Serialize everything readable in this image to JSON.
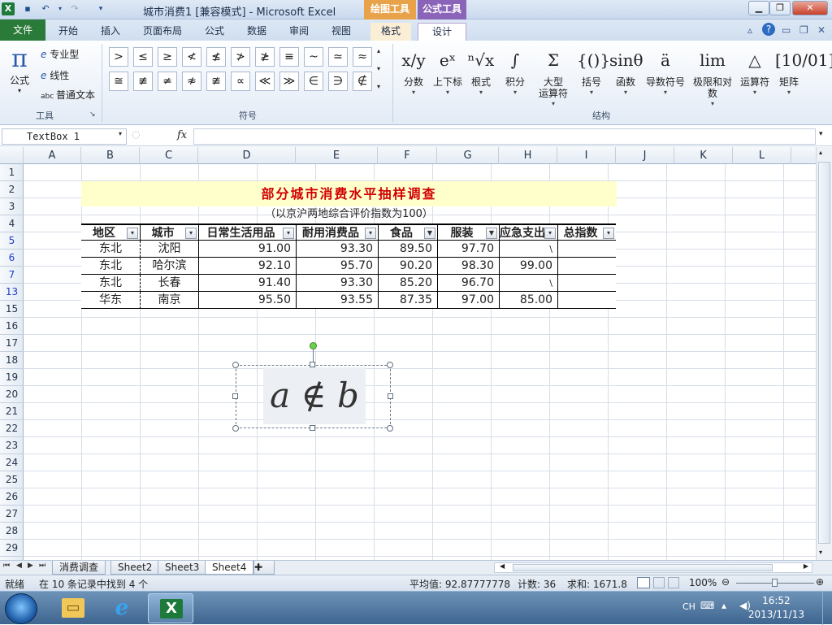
{
  "window": {
    "title": "城市消费1  [兼容模式] - Microsoft Excel",
    "context_tab_drawing": "绘图工具",
    "context_tab_formula": "公式工具"
  },
  "tabs": [
    "文件",
    "开始",
    "插入",
    "页面布局",
    "公式",
    "数据",
    "审阅",
    "视图",
    "格式",
    "设计"
  ],
  "ribbon": {
    "tools_group": {
      "formula_label": "公式",
      "professional": "专业型",
      "linear": "线性",
      "plain_text": "普通文本",
      "group_label": "工具"
    },
    "symbols_group": {
      "row1": [
        ">",
        "≤",
        "≥",
        "≮",
        "≰",
        "≯",
        "≱",
        "≡",
        "~",
        "≃",
        "≈"
      ],
      "row2": [
        "≅",
        "≢",
        "≄",
        "≉",
        "≇",
        "∝",
        "≪",
        "≫",
        "∈",
        "∋",
        "∉"
      ],
      "group_label": "符号"
    },
    "structures_group": {
      "items": [
        {
          "glyph": "x/y",
          "label": "分数"
        },
        {
          "glyph": "eˣ",
          "label": "上下标"
        },
        {
          "glyph": "ⁿ√x",
          "label": "根式"
        },
        {
          "glyph": "∫",
          "label": "积分"
        },
        {
          "glyph": "Σ",
          "label": "大型\n运算符"
        },
        {
          "glyph": "{()}",
          "label": "括号"
        },
        {
          "glyph": "sinθ",
          "label": "函数"
        },
        {
          "glyph": "ä",
          "label": "导数符号"
        },
        {
          "glyph": "lim",
          "label": "极限和对数"
        },
        {
          "glyph": "△",
          "label": "运算符"
        },
        {
          "glyph": "[10/01]",
          "label": "矩阵"
        }
      ],
      "group_label": "结构"
    }
  },
  "formula_bar": {
    "name_box": "TextBox 1",
    "fx": "fx",
    "value": ""
  },
  "columns": [
    "A",
    "B",
    "C",
    "D",
    "E",
    "F",
    "G",
    "H",
    "I",
    "J",
    "K",
    "L"
  ],
  "rows": [
    "1",
    "2",
    "3",
    "4",
    "5",
    "6",
    "7",
    "13",
    "15",
    "16",
    "17",
    "18",
    "19",
    "20",
    "21",
    "22",
    "23",
    "24",
    "25",
    "26",
    "27",
    "28",
    "29"
  ],
  "sheet": {
    "title": "部分城市消费水平抽样调查",
    "subtitle": "（以京沪两地综合评价指数为100）",
    "headers": [
      "地区",
      "城市",
      "日常生活用品",
      "耐用消费品",
      "食品",
      "服装",
      "应急支出",
      "总指数"
    ],
    "data": [
      [
        "东北",
        "沈阳",
        "91.00",
        "93.30",
        "89.50",
        "97.70",
        "\\",
        ""
      ],
      [
        "东北",
        "哈尔滨",
        "92.10",
        "95.70",
        "90.20",
        "98.30",
        "99.00",
        ""
      ],
      [
        "东北",
        "长春",
        "91.40",
        "93.30",
        "85.20",
        "96.70",
        "\\",
        ""
      ],
      [
        "华东",
        "南京",
        "95.50",
        "93.55",
        "87.35",
        "97.00",
        "85.00",
        ""
      ]
    ]
  },
  "equation": "a ∉ b",
  "sheet_tabs": [
    "消费调查",
    "Sheet2",
    "Sheet3",
    "Sheet4"
  ],
  "status": {
    "ready": "就绪",
    "filter_msg": "在 10 条记录中找到 4 个",
    "average": "平均值: 92.87777778",
    "count": "计数: 36",
    "sum": "求和: 1671.8",
    "zoom": "100%"
  },
  "taskbar": {
    "lang": "CH",
    "time": "16:52",
    "date": "2013/11/13"
  }
}
